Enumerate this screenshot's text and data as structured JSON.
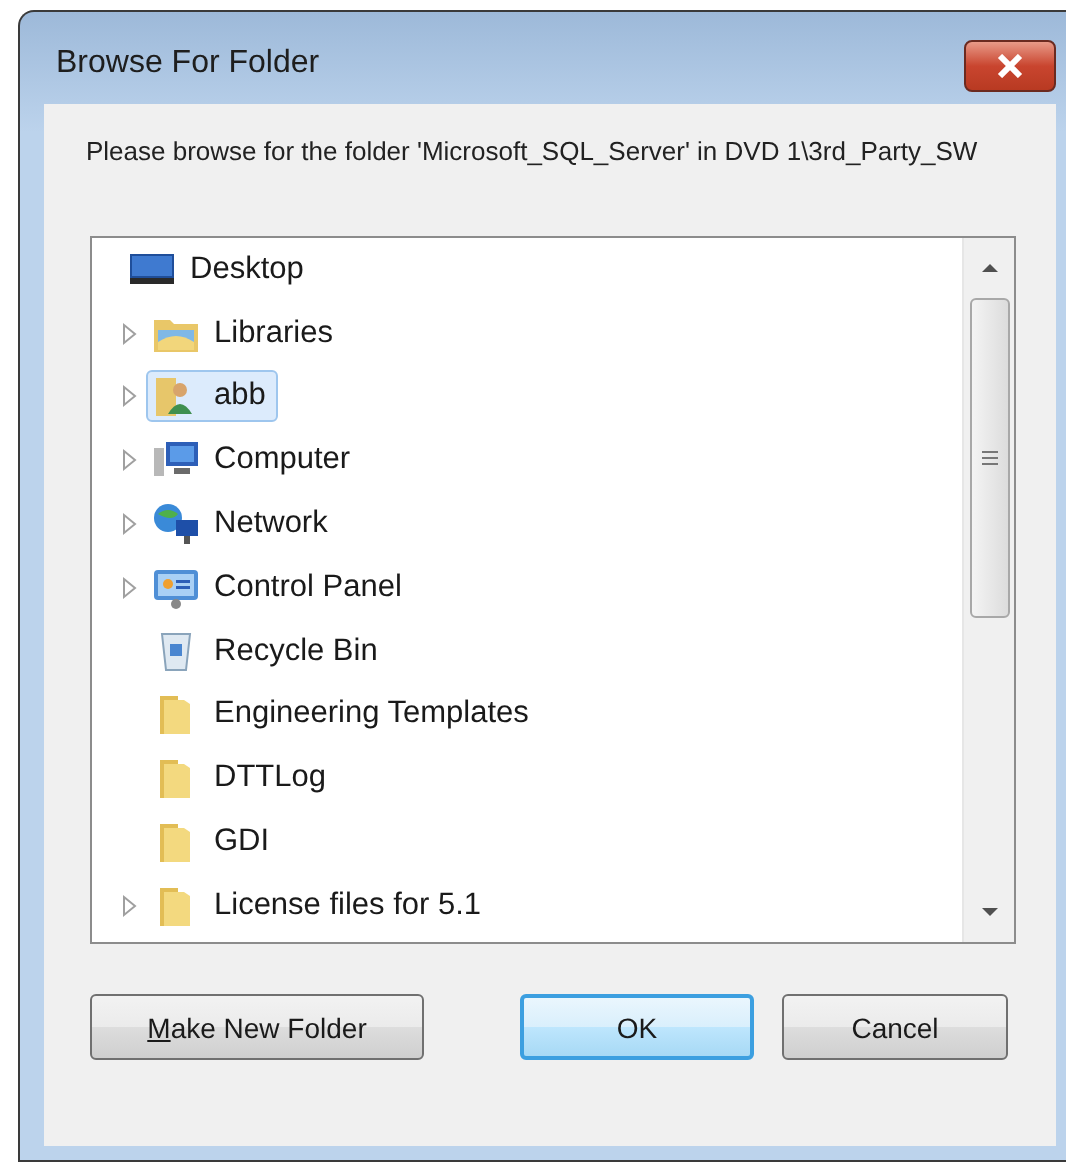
{
  "window": {
    "title": "Browse For Folder"
  },
  "message": "Please browse for the folder 'Microsoft_SQL_Server' in DVD 1\\3rd_Party_SW",
  "tree": [
    {
      "label": "Desktop",
      "kind": "desktop",
      "selected": false,
      "expandable": false,
      "children": [
        {
          "label": "Libraries",
          "kind": "libraries",
          "selected": false,
          "expandable": true
        },
        {
          "label": "abb",
          "kind": "user",
          "selected": true,
          "expandable": true
        },
        {
          "label": "Computer",
          "kind": "computer",
          "selected": false,
          "expandable": true
        },
        {
          "label": "Network",
          "kind": "network",
          "selected": false,
          "expandable": true
        },
        {
          "label": "Control Panel",
          "kind": "control-panel",
          "selected": false,
          "expandable": true
        },
        {
          "label": "Recycle Bin",
          "kind": "recycle-bin",
          "selected": false,
          "expandable": false
        },
        {
          "label": "Engineering Templates",
          "kind": "folder",
          "selected": false,
          "expandable": false
        },
        {
          "label": "DTTLog",
          "kind": "folder",
          "selected": false,
          "expandable": false
        },
        {
          "label": "GDI",
          "kind": "folder",
          "selected": false,
          "expandable": false
        },
        {
          "label": "License files for 5.1",
          "kind": "folder",
          "selected": false,
          "expandable": true
        }
      ]
    }
  ],
  "buttons": [
    {
      "label": "Make New Folder",
      "default": false
    },
    {
      "label": "OK",
      "default": true
    },
    {
      "label": "Cancel",
      "default": false
    }
  ]
}
